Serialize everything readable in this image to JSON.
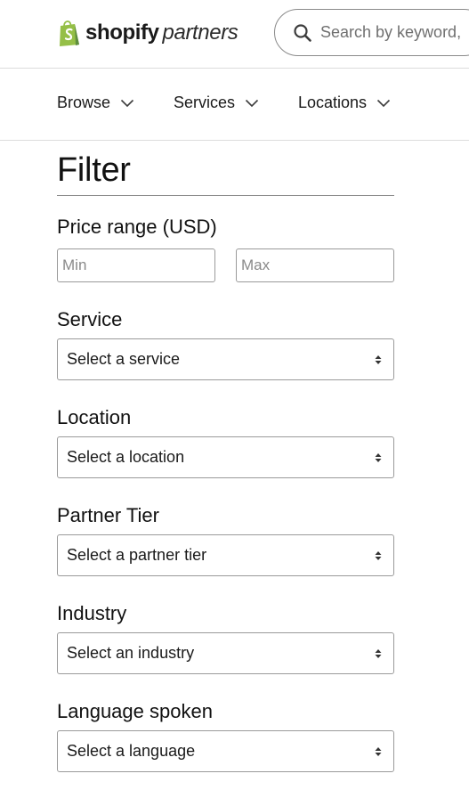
{
  "header": {
    "logo_brand": "shopify",
    "logo_suffix": "partners",
    "brand_color": "#95bf47",
    "search": {
      "placeholder": "Search by keyword,"
    }
  },
  "nav": {
    "items": [
      {
        "label": "Browse"
      },
      {
        "label": "Services"
      },
      {
        "label": "Locations"
      }
    ]
  },
  "filter": {
    "title": "Filter",
    "price": {
      "label": "Price range (USD)",
      "min_placeholder": "Min",
      "max_placeholder": "Max"
    },
    "service": {
      "label": "Service",
      "selected": "Select a service"
    },
    "location": {
      "label": "Location",
      "selected": "Select a location"
    },
    "tier": {
      "label": "Partner Tier",
      "selected": "Select a partner tier"
    },
    "industry": {
      "label": "Industry",
      "selected": "Select an industry"
    },
    "language": {
      "label": "Language spoken",
      "selected": "Select a language"
    }
  }
}
